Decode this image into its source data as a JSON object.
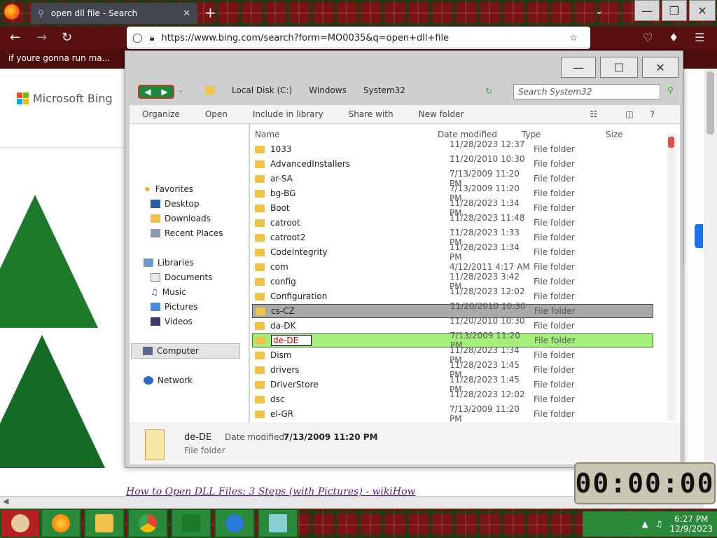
{
  "browser": {
    "tab_title": "open dll file - Search",
    "url": "https://www.bing.com/search?form=MO0035&q=open+dll+file",
    "bookmark": "if youre gonna run ma..."
  },
  "bing": {
    "logo_text": "Microsoft Bing",
    "result_title": "How to Open DLL Files: 3 Steps (with Pictures) - wikiHow"
  },
  "explorer": {
    "breadcrumb": [
      "Local Disk (C:)",
      "Windows",
      "System32"
    ],
    "search_placeholder": "Search System32",
    "commands": [
      "Organize",
      "Open",
      "Include in library",
      "Share with",
      "New folder"
    ],
    "nav": {
      "favorites": "Favorites",
      "favorites_items": [
        "Desktop",
        "Downloads",
        "Recent Places"
      ],
      "libraries": "Libraries",
      "libraries_items": [
        "Documents",
        "Music",
        "Pictures",
        "Videos"
      ],
      "computer": "Computer",
      "network": "Network"
    },
    "columns": [
      "Name",
      "Date modified",
      "Type",
      "Size"
    ],
    "rows": [
      {
        "name": "1033",
        "date": "11/28/2023 12:37 ...",
        "type": "File folder"
      },
      {
        "name": "AdvancedInstallers",
        "date": "11/20/2010 10:30 ...",
        "type": "File folder"
      },
      {
        "name": "ar-SA",
        "date": "7/13/2009 11:20 PM",
        "type": "File folder"
      },
      {
        "name": "bg-BG",
        "date": "7/13/2009 11:20 PM",
        "type": "File folder"
      },
      {
        "name": "Boot",
        "date": "11/28/2023 1:34 PM",
        "type": "File folder"
      },
      {
        "name": "catroot",
        "date": "11/28/2023 11:48 ...",
        "type": "File folder"
      },
      {
        "name": "catroot2",
        "date": "11/28/2023 1:33 PM",
        "type": "File folder"
      },
      {
        "name": "CodeIntegrity",
        "date": "11/28/2023 1:34 PM",
        "type": "File folder"
      },
      {
        "name": "com",
        "date": "4/12/2011 4:17 AM",
        "type": "File folder"
      },
      {
        "name": "config",
        "date": "11/28/2023 3:42 PM",
        "type": "File folder"
      },
      {
        "name": "Configuration",
        "date": "11/28/2023 12:02 ...",
        "type": "File folder"
      },
      {
        "name": "cs-CZ",
        "date": "11/20/2010 10:30 ...",
        "type": "File folder"
      },
      {
        "name": "da-DK",
        "date": "11/20/2010 10:30 ...",
        "type": "File folder"
      },
      {
        "name": "de-DE",
        "date": "7/13/2009 11:20 PM",
        "type": "File folder"
      },
      {
        "name": "Dism",
        "date": "11/28/2023 1:34 PM",
        "type": "File folder"
      },
      {
        "name": "drivers",
        "date": "11/28/2023 1:45 PM",
        "type": "File folder"
      },
      {
        "name": "DriverStore",
        "date": "11/28/2023 1:45 PM",
        "type": "File folder"
      },
      {
        "name": "dsc",
        "date": "11/28/2023 12:02 ...",
        "type": "File folder"
      },
      {
        "name": "el-GR",
        "date": "7/13/2009 11:20 PM",
        "type": "File folder"
      }
    ],
    "details": {
      "name": "de-DE",
      "date_label": "Date modified:",
      "date_value": "7/13/2009 11:20 PM",
      "type": "File folder"
    }
  },
  "widget_timer": "00:00:00",
  "taskbar": {
    "time": "6:27 PM",
    "date": "12/9/2023"
  }
}
